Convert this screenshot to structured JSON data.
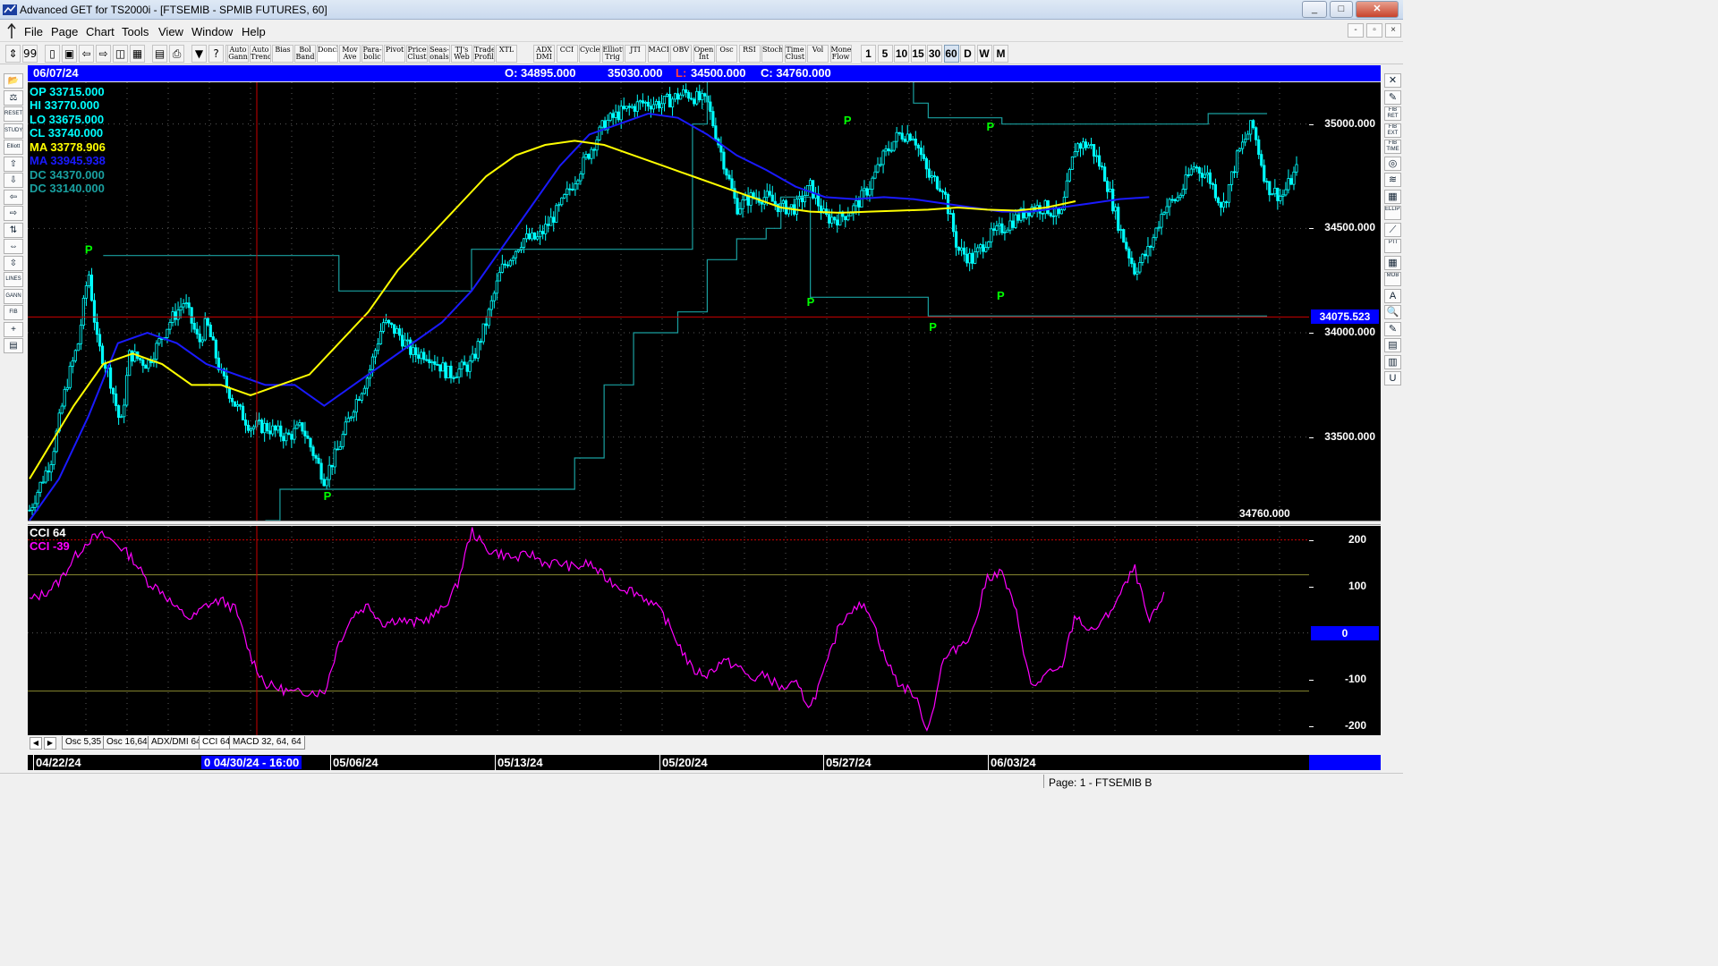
{
  "window": {
    "title": "Advanced GET for TS2000i - [FTSEMIB - SPMIB FUTURES, 60]",
    "controls": [
      "_",
      "□",
      "✕"
    ]
  },
  "menu": {
    "items": [
      "File",
      "Page",
      "Chart",
      "Tools",
      "View",
      "Window",
      "Help"
    ],
    "mdi_controls": [
      "-",
      "▫",
      "×"
    ]
  },
  "toolbar": {
    "icon_buttons": [
      "⇕",
      "99",
      "▯",
      "▣",
      "⇦",
      "⇨",
      "◫",
      "▦",
      "▤",
      "⎙",
      "▼",
      "?",
      "⚙"
    ],
    "study_buttons": [
      "Auto\nGann",
      "Auto\nTrend",
      "Bias",
      "Bol\nBand",
      "Donch",
      "Mov\nAve",
      "Para-\nbolic",
      "Pivot",
      "Price\nClust",
      "Seas-\nonals",
      "TJ's\nWeb",
      "Trade\nProfile",
      "XTL"
    ],
    "indicator_buttons": [
      "ADX\nDMI",
      "CCI",
      "Cycles",
      "Elliott\nTrig",
      "JTI",
      "MACD",
      "OBV",
      "Open\nInt",
      "Osc",
      "RSI",
      "Stoch",
      "Time\nClust",
      "Vol",
      "Money\nFlow"
    ],
    "periods": [
      "1",
      "5",
      "10",
      "15",
      "30",
      "60",
      "D",
      "W",
      "M"
    ],
    "selected_period": "60"
  },
  "left_tools": [
    "📂",
    "⚖",
    "RESET",
    "STUDY",
    "Elliott",
    "⇧",
    "⇩",
    "⇦",
    "⇨",
    "⇅",
    "⇔",
    "⇳",
    "LINES",
    "GANN",
    "FIB",
    "+",
    "▤"
  ],
  "right_tools": [
    "✕",
    "✎",
    "FIB RET",
    "FIB EXT",
    "FIB TIME",
    "◎",
    "≋",
    "▦",
    "ELLIPS",
    "⟋",
    "PTI",
    "▦",
    "MOB",
    "A",
    "🔍",
    "✎",
    "▤",
    "▥",
    "U"
  ],
  "header": {
    "date": "06/07/24",
    "open": "O: 34895.000",
    "high": "35030.000",
    "low_label": "L:",
    "low": "34500.000",
    "close": "C: 34760.000"
  },
  "legend": {
    "op": "OP  33715.000",
    "hi": "HI   33770.000",
    "lo": "LO   33675.000",
    "cl": "CL   33740.000",
    "ma": "MA  33778.906",
    "ma2": "MA  33945.938",
    "dc1": "DC  34370.000",
    "dc2": "DC  33140.000"
  },
  "price_axis": {
    "ticks": [
      {
        "label": "35000.000",
        "value": 35000
      },
      {
        "label": "34500.000",
        "value": 34500
      },
      {
        "label": "34000.000",
        "value": 34000
      },
      {
        "label": "33500.000",
        "value": 33500
      }
    ],
    "cursor_label": "34075.523",
    "last_price_label": "34760.000"
  },
  "cci": {
    "title": "CCI 64",
    "value_label": "CCI  -39",
    "ticks": [
      {
        "label": "200",
        "value": 200
      },
      {
        "label": "100",
        "value": 100
      },
      {
        "label": "-100",
        "value": -100
      },
      {
        "label": "-200",
        "value": -200
      }
    ],
    "zero_label": "0"
  },
  "tabs": {
    "arrows": [
      "◀",
      "▶"
    ],
    "items": [
      "Osc 5,35",
      "Osc 16,64",
      "ADX/DMI 64",
      "CCI 64",
      "MACD 32, 64, 64"
    ],
    "active": "CCI 64"
  },
  "dates": {
    "labels": [
      "04/22/24",
      "05/06/24",
      "05/13/24",
      "05/20/24",
      "05/27/24",
      "06/03/24"
    ],
    "cursor": "0 04/30/24 - 16:00"
  },
  "status": {
    "text": "Page: 1 - FTSEMIB B"
  },
  "colors": {
    "background": "#000000",
    "candles": "#00ffff",
    "ma_yellow": "#ffff00",
    "ma_blue": "#1a1aff",
    "donchian": "#1aa0a0",
    "pivot": "#00ff00",
    "cci": "#ff00ff",
    "cursor": "#cc0000"
  },
  "pivot_label": "P",
  "chart_data": {
    "type": "candlestick",
    "price_range": [
      33100,
      35200
    ],
    "cci_range": [
      -220,
      230
    ],
    "price_path": [
      [
        0,
        33150
      ],
      [
        1.5,
        33400
      ],
      [
        2.5,
        33750
      ],
      [
        3.3,
        33950
      ],
      [
        4,
        34300
      ],
      [
        4.6,
        33950
      ],
      [
        5.4,
        33800
      ],
      [
        6.2,
        33550
      ],
      [
        6.8,
        33900
      ],
      [
        8,
        33850
      ],
      [
        9.5,
        34050
      ],
      [
        10.5,
        34150
      ],
      [
        11.5,
        33950
      ],
      [
        12,
        34050
      ],
      [
        13,
        33800
      ],
      [
        14,
        33650
      ],
      [
        15,
        33550
      ],
      [
        16,
        33550
      ],
      [
        17.5,
        33500
      ],
      [
        18.5,
        33550
      ],
      [
        20,
        33300
      ],
      [
        21,
        33450
      ],
      [
        22,
        33650
      ],
      [
        23,
        33800
      ],
      [
        24,
        34050
      ],
      [
        25,
        34000
      ],
      [
        26,
        33900
      ],
      [
        27,
        33900
      ],
      [
        28.5,
        33800
      ],
      [
        30,
        33850
      ],
      [
        31,
        34050
      ],
      [
        32,
        34300
      ],
      [
        33.5,
        34450
      ],
      [
        34.5,
        34450
      ],
      [
        36,
        34600
      ],
      [
        37.5,
        34800
      ],
      [
        39,
        35000
      ],
      [
        40,
        35050
      ],
      [
        41.5,
        35100
      ],
      [
        43,
        35100
      ],
      [
        44.5,
        35150
      ],
      [
        46,
        35100
      ],
      [
        47,
        34850
      ],
      [
        48,
        34600
      ],
      [
        49,
        34650
      ],
      [
        50,
        34650
      ],
      [
        51,
        34600
      ],
      [
        52,
        34600
      ],
      [
        53,
        34700
      ],
      [
        54,
        34550
      ],
      [
        55,
        34550
      ],
      [
        56,
        34600
      ],
      [
        57,
        34700
      ],
      [
        58,
        34850
      ],
      [
        59,
        34950
      ],
      [
        60,
        34950
      ],
      [
        61,
        34750
      ],
      [
        62,
        34700
      ],
      [
        63,
        34400
      ],
      [
        64,
        34350
      ],
      [
        65,
        34450
      ],
      [
        66,
        34500
      ],
      [
        67,
        34550
      ],
      [
        68,
        34600
      ],
      [
        69,
        34600
      ],
      [
        70,
        34550
      ],
      [
        71,
        34900
      ],
      [
        72,
        34900
      ],
      [
        73,
        34750
      ],
      [
        74,
        34500
      ],
      [
        75,
        34300
      ],
      [
        76,
        34400
      ],
      [
        77,
        34600
      ],
      [
        78,
        34650
      ],
      [
        79,
        34800
      ],
      [
        80,
        34750
      ],
      [
        81,
        34600
      ],
      [
        82,
        34850
      ],
      [
        83,
        35000
      ],
      [
        84,
        34700
      ],
      [
        85,
        34650
      ],
      [
        86,
        34780
      ]
    ],
    "ma_yellow": [
      [
        0,
        33300
      ],
      [
        3,
        33650
      ],
      [
        5,
        33850
      ],
      [
        7,
        33900
      ],
      [
        9,
        33850
      ],
      [
        11,
        33750
      ],
      [
        13,
        33750
      ],
      [
        15,
        33700
      ],
      [
        17,
        33750
      ],
      [
        19,
        33800
      ],
      [
        21,
        33950
      ],
      [
        23,
        34100
      ],
      [
        25,
        34300
      ],
      [
        27,
        34450
      ],
      [
        29,
        34600
      ],
      [
        31,
        34750
      ],
      [
        33,
        34850
      ],
      [
        35,
        34900
      ],
      [
        37,
        34920
      ],
      [
        39,
        34900
      ],
      [
        41,
        34850
      ],
      [
        43,
        34800
      ],
      [
        45,
        34750
      ],
      [
        47,
        34700
      ],
      [
        49,
        34650
      ],
      [
        51,
        34600
      ],
      [
        53,
        34580
      ],
      [
        55,
        34575
      ],
      [
        57,
        34580
      ],
      [
        59,
        34585
      ],
      [
        61,
        34590
      ],
      [
        63,
        34600
      ],
      [
        65,
        34590
      ],
      [
        67,
        34585
      ],
      [
        69,
        34600
      ],
      [
        71,
        34630
      ]
    ],
    "ma_blue": [
      [
        0,
        33100
      ],
      [
        2,
        33300
      ],
      [
        4,
        33600
      ],
      [
        6,
        33950
      ],
      [
        8,
        34000
      ],
      [
        10,
        33950
      ],
      [
        12,
        33850
      ],
      [
        14,
        33800
      ],
      [
        16,
        33750
      ],
      [
        18,
        33750
      ],
      [
        20,
        33650
      ],
      [
        22,
        33750
      ],
      [
        24,
        33850
      ],
      [
        26,
        33950
      ],
      [
        28,
        34050
      ],
      [
        30,
        34200
      ],
      [
        32,
        34400
      ],
      [
        34,
        34600
      ],
      [
        36,
        34800
      ],
      [
        38,
        34950
      ],
      [
        40,
        35000
      ],
      [
        42,
        35050
      ],
      [
        44,
        35030
      ],
      [
        46,
        34950
      ],
      [
        48,
        34850
      ],
      [
        50,
        34780
      ],
      [
        52,
        34700
      ],
      [
        54,
        34650
      ],
      [
        56,
        34640
      ],
      [
        58,
        34650
      ],
      [
        60,
        34640
      ],
      [
        62,
        34620
      ],
      [
        64,
        34600
      ],
      [
        66,
        34580
      ],
      [
        68,
        34580
      ],
      [
        70,
        34600
      ],
      [
        72,
        34620
      ],
      [
        74,
        34640
      ],
      [
        76,
        34650
      ]
    ],
    "donchian_upper": [
      [
        5,
        34370
      ],
      [
        20,
        34370
      ],
      [
        21,
        34200
      ],
      [
        28,
        34200
      ],
      [
        30,
        34400
      ],
      [
        44,
        34400
      ],
      [
        45,
        35000
      ],
      [
        46,
        35250
      ],
      [
        58,
        35250
      ],
      [
        60,
        35100
      ],
      [
        61,
        35030
      ],
      [
        65,
        35030
      ],
      [
        66,
        35000
      ],
      [
        75,
        35000
      ],
      [
        80,
        35050
      ],
      [
        84,
        35050
      ]
    ],
    "donchian_lower": [
      [
        16,
        33100
      ],
      [
        17,
        33250
      ],
      [
        21,
        33250
      ],
      [
        36,
        33250
      ],
      [
        37,
        33400
      ],
      [
        39,
        33750
      ],
      [
        41,
        34000
      ],
      [
        44,
        34100
      ],
      [
        46,
        34350
      ],
      [
        48,
        34450
      ],
      [
        50,
        34500
      ],
      [
        51,
        34650
      ],
      [
        52,
        34650
      ],
      [
        53,
        34170
      ],
      [
        60,
        34170
      ],
      [
        61,
        34080
      ],
      [
        84,
        34080
      ]
    ],
    "pivots": [
      {
        "x": 4,
        "price": 34400
      },
      {
        "x": 20.2,
        "price": 33220
      },
      {
        "x": 53,
        "price": 34150
      },
      {
        "x": 55.5,
        "price": 35020
      },
      {
        "x": 61.3,
        "price": 34030
      },
      {
        "x": 65.2,
        "price": 34990
      },
      {
        "x": 65.9,
        "price": 34180
      }
    ],
    "cci": [
      [
        0,
        70
      ],
      [
        1,
        85
      ],
      [
        2,
        110
      ],
      [
        3,
        160
      ],
      [
        4,
        200
      ],
      [
        5,
        210
      ],
      [
        6,
        190
      ],
      [
        7,
        160
      ],
      [
        8,
        110
      ],
      [
        9,
        90
      ],
      [
        10,
        50
      ],
      [
        11,
        30
      ],
      [
        12,
        60
      ],
      [
        13,
        70
      ],
      [
        14,
        50
      ],
      [
        15,
        -50
      ],
      [
        16,
        -110
      ],
      [
        17,
        -120
      ],
      [
        18,
        -130
      ],
      [
        19,
        -125
      ],
      [
        20,
        -130
      ],
      [
        21,
        -20
      ],
      [
        22,
        40
      ],
      [
        23,
        60
      ],
      [
        24,
        20
      ],
      [
        25,
        30
      ],
      [
        26,
        20
      ],
      [
        27,
        30
      ],
      [
        28,
        50
      ],
      [
        29,
        100
      ],
      [
        30,
        220
      ],
      [
        31,
        180
      ],
      [
        32,
        170
      ],
      [
        33,
        160
      ],
      [
        34,
        170
      ],
      [
        35,
        150
      ],
      [
        36,
        150
      ],
      [
        37,
        140
      ],
      [
        38,
        150
      ],
      [
        39,
        120
      ],
      [
        40,
        100
      ],
      [
        41,
        90
      ],
      [
        42,
        70
      ],
      [
        43,
        40
      ],
      [
        44,
        -20
      ],
      [
        45,
        -80
      ],
      [
        46,
        -90
      ],
      [
        47,
        -60
      ],
      [
        48,
        -70
      ],
      [
        49,
        -100
      ],
      [
        50,
        -90
      ],
      [
        51,
        -120
      ],
      [
        52,
        -110
      ],
      [
        53,
        -160
      ],
      [
        54,
        -80
      ],
      [
        55,
        20
      ],
      [
        56,
        60
      ],
      [
        57,
        50
      ],
      [
        58,
        -50
      ],
      [
        59,
        -110
      ],
      [
        60,
        -130
      ],
      [
        61,
        -210
      ],
      [
        62,
        -60
      ],
      [
        63,
        -30
      ],
      [
        64,
        0
      ],
      [
        65,
        120
      ],
      [
        66,
        130
      ],
      [
        67,
        40
      ],
      [
        68,
        -120
      ],
      [
        69,
        -90
      ],
      [
        70,
        -80
      ],
      [
        71,
        40
      ],
      [
        72,
        0
      ],
      [
        73,
        30
      ],
      [
        74,
        80
      ],
      [
        75,
        140
      ],
      [
        76,
        20
      ],
      [
        77,
        80
      ]
    ]
  }
}
